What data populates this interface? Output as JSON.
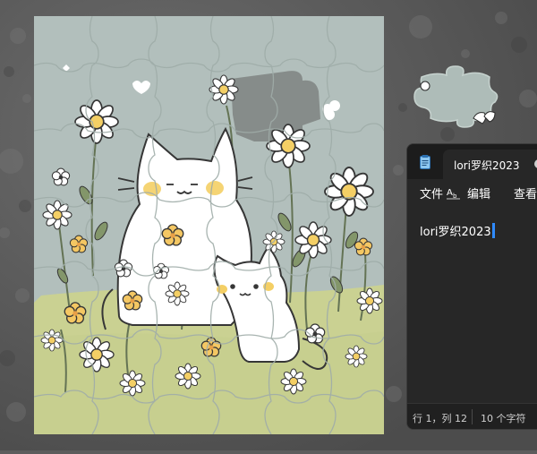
{
  "notepad": {
    "tab_title": "lori罗织2023",
    "menu": {
      "file": "文件",
      "edit": "编辑",
      "view": "查看"
    },
    "document_text": "lori罗织2023",
    "status": {
      "position": "行 1，列 12",
      "char_count": "10 个字符"
    }
  },
  "icons": {
    "app": "notepad-icon",
    "format": "text-format-icon",
    "tab_indicator": "unsaved-dot-icon"
  },
  "colors": {
    "desktop": "#5c5c5c",
    "window_bg": "#272727",
    "titlebar": "#1c1c1c",
    "caret": "#2f8bff",
    "puzzle_sky": "#aebcb8",
    "puzzle_grass": "#c7cf8c",
    "flower_yellow": "#f4cd5c"
  }
}
